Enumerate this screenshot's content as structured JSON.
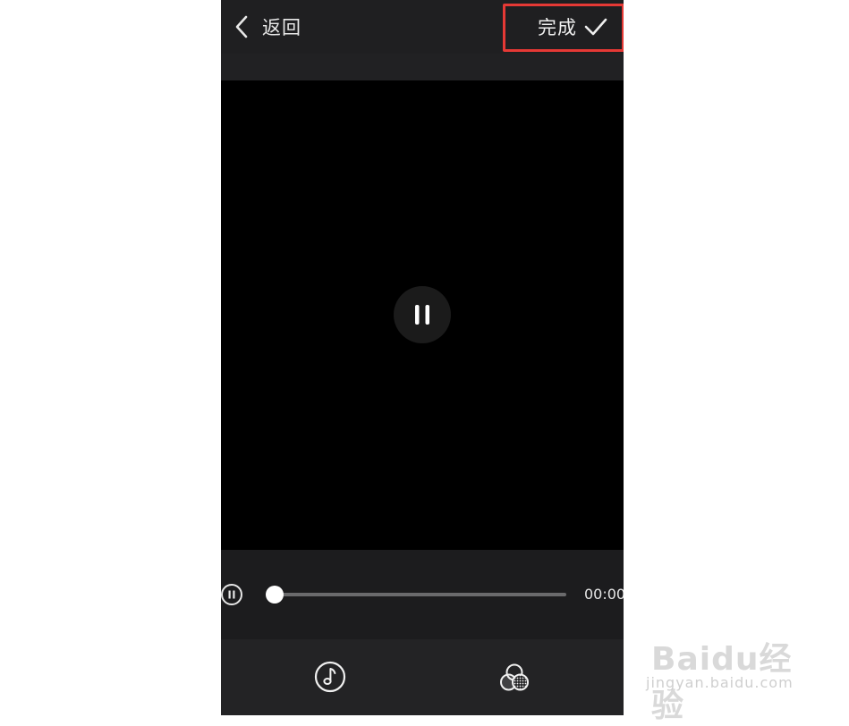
{
  "topbar": {
    "back_label": "返回",
    "done_label": "完成",
    "highlight_color": "#e53935"
  },
  "player": {
    "state_icon": "pause-icon",
    "progress": 0,
    "time": "00:00"
  },
  "toolbar": {
    "items": [
      {
        "icon": "music-note-icon"
      },
      {
        "icon": "filter-icon"
      }
    ]
  },
  "watermark": {
    "logo": "Baidu经验",
    "sub": "jingyan.baidu.com"
  }
}
